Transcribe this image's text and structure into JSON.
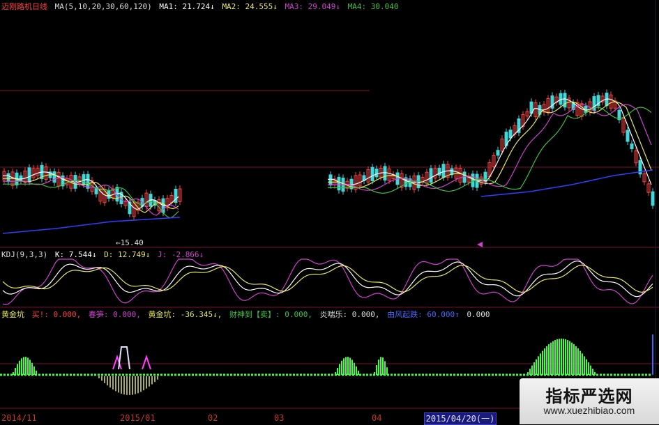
{
  "colors": {
    "background": "#000000",
    "up_candle": "#ff4040",
    "down_candle": "#40d8d8",
    "ma1": "#ffffff",
    "ma2": "#e8e860",
    "ma3": "#d040d0",
    "ma4": "#40c040",
    "ma_long": "#3040ff",
    "kdj_k": "#ffffff",
    "kdj_d": "#e8e860",
    "kdj_j": "#d040d0",
    "gold_bar": "#40ff40",
    "divider": "#7a1030"
  },
  "main_panel": {
    "title": "迈刚路机",
    "period": "日线",
    "ma_params": "MA(5,10,20,30,60,120)",
    "ma1": "MA1: 21.724↓",
    "ma2": "MA2: 24.555↓",
    "ma3": "MA3: 29.049↓",
    "ma4": "MA4: 30.040",
    "lowest_label": "←15.40"
  },
  "kdj_panel": {
    "name": "KDJ(9,3,3)",
    "k": "K: 7.544↓",
    "d": "D: 12.749↓",
    "j": "J: -2.866↓"
  },
  "gold_panel": {
    "name": "黄金坑",
    "buy": "买!: 0.000,",
    "spring": "春笋: 0.000,",
    "gold_pit": "黄金坑: -36.345↓,",
    "wealth": "财神到【卖】: 0.000,",
    "joy": "炎喘乐: 0.000,",
    "wind": "由风起跌: 60.000↑",
    "last": "0.000"
  },
  "x_axis": {
    "labels": [
      "2014/11",
      "2015/01",
      "02",
      "03",
      "04"
    ],
    "selected_date": "2015/04/20(一)"
  },
  "watermark": {
    "title": "指标严选网",
    "url": "www.xuezhibiao.com"
  }
}
